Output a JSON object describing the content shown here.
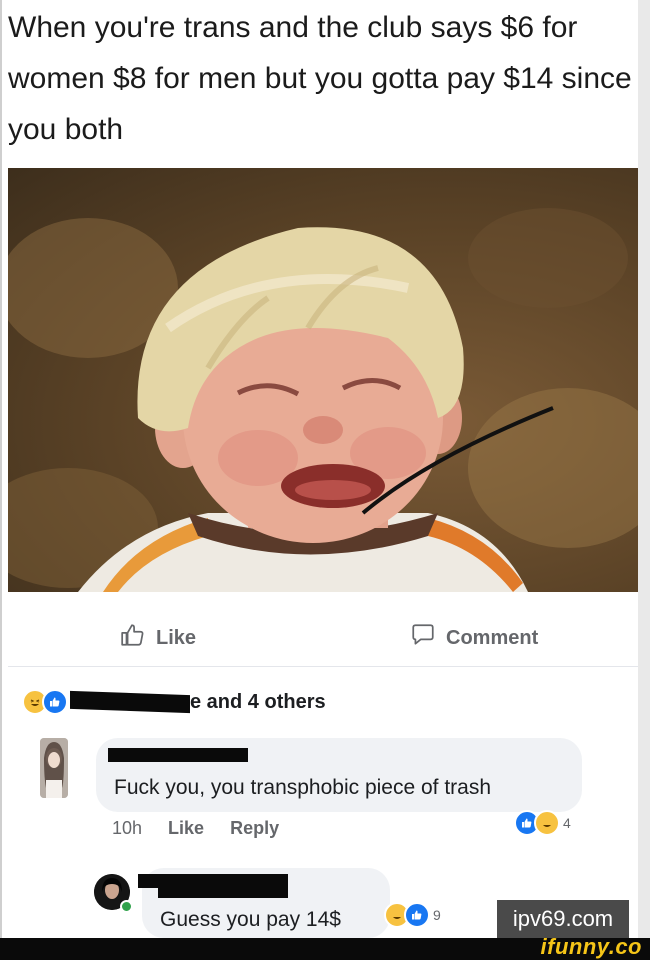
{
  "post": {
    "caption": "When you're trans and the club says $6 for women $8 for men but you gotta pay $14 since you both"
  },
  "actions": {
    "like_label": "Like",
    "comment_label": "Comment"
  },
  "reactions": {
    "summary_suffix": "e and 4 others"
  },
  "comments": [
    {
      "text": "Fuck you, you transphobic piece of trash",
      "time": "10h",
      "like_label": "Like",
      "reply_label": "Reply",
      "reaction_count": "4"
    },
    {
      "text": "Guess you pay 14$",
      "reaction_count": "9"
    }
  ],
  "watermarks": {
    "site": "ipv69.com",
    "brand": "ifunny.co"
  },
  "colors": {
    "like_blue": "#1877f2",
    "haha_yellow": "#f7c240",
    "online_green": "#31a24c"
  }
}
